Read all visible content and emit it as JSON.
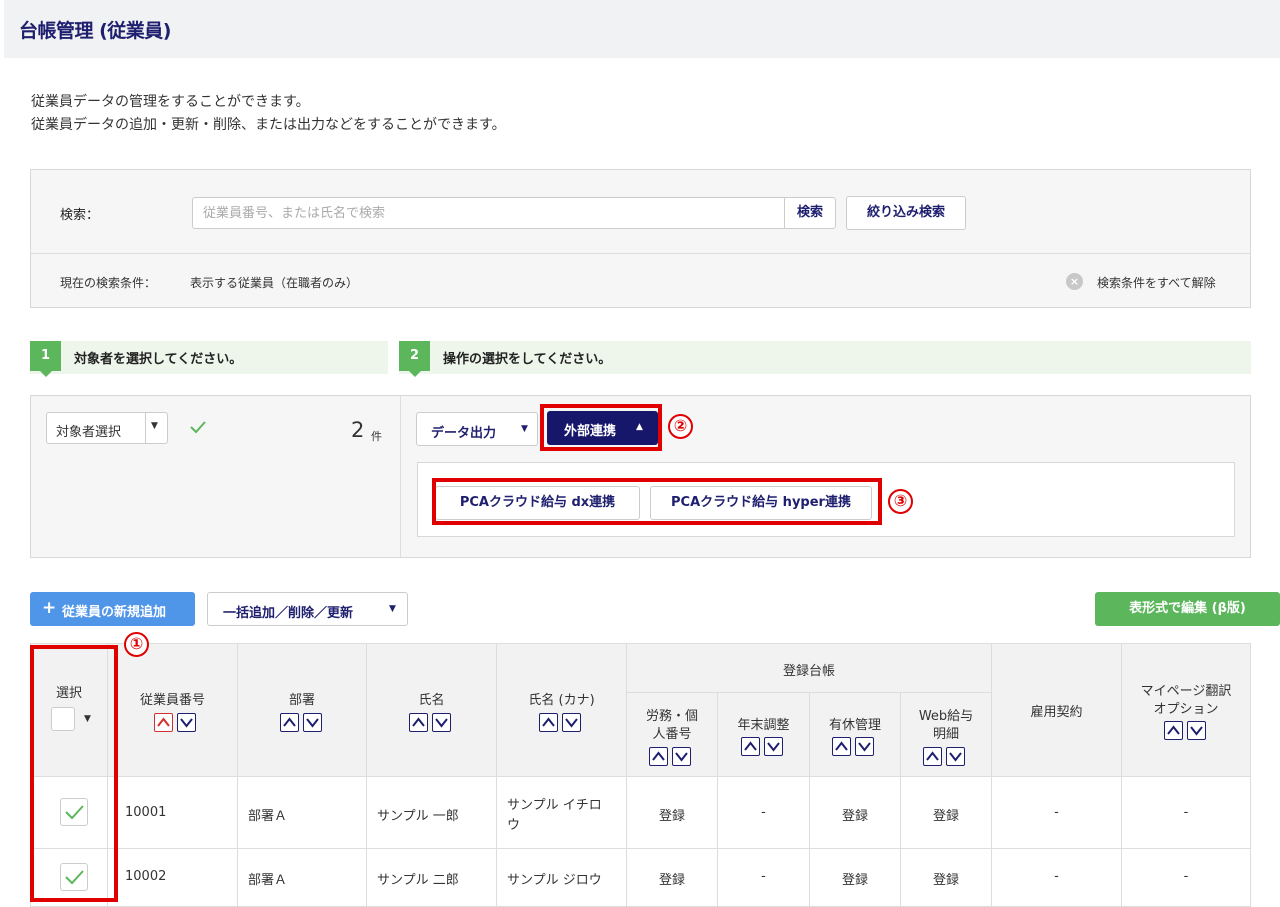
{
  "header": {
    "title": "台帳管理 (従業員)"
  },
  "description": {
    "line1": "従業員データの管理をすることができます。",
    "line2": "従業員データの追加・更新・削除、または出力などをすることができます。"
  },
  "search": {
    "label": "検索：",
    "placeholder": "従業員番号、または氏名で検索",
    "search_button": "検索",
    "filter_button": "絞り込み検索",
    "condition_label": "現在の検索条件：",
    "condition_value": "表示する従業員（在職者のみ）",
    "clear_all": "検索条件をすべて解除"
  },
  "steps": [
    {
      "number": "1",
      "label": "対象者を選択してください。"
    },
    {
      "number": "2",
      "label": "操作の選択をしてください。"
    }
  ],
  "selection": {
    "dropdown_label": "対象者選択",
    "count": "2",
    "count_unit": "件"
  },
  "operations": {
    "data_output": "データ出力",
    "external_link": "外部連携",
    "pca_dx": "PCAクラウド給与 dx連携",
    "pca_hyper": "PCAクラウド給与 hyper連携"
  },
  "annotations": {
    "one": "①",
    "two": "②",
    "three": "③"
  },
  "toolbar": {
    "add_employee": "従業員の新規追加",
    "bulk": "一括追加／削除／更新",
    "table_edit": "表形式で編集 (β版)"
  },
  "table": {
    "headers": {
      "select": "選択",
      "emp_no": "従業員番号",
      "dept": "部署",
      "name": "氏名",
      "kana": "氏名 (カナ)",
      "registry": "登録台帳",
      "labor_l1": "労務・個",
      "labor_l2": "人番号",
      "year_end": "年末調整",
      "leave": "有休管理",
      "web_l1": "Web給与",
      "web_l2": "明細",
      "contract": "雇用契約",
      "mypage_l1": "マイページ翻訳",
      "mypage_l2": "オプション"
    },
    "rows": [
      {
        "emp_no": "10001",
        "dept": "部署Ａ",
        "name": "サンプル 一郎",
        "kana_l1": "サンプル イチロ",
        "kana_l2": "ウ",
        "labor": "登録",
        "year_end": "-",
        "leave": "登録",
        "web": "登録",
        "contract": "-",
        "mypage": "-"
      },
      {
        "emp_no": "10002",
        "dept": "部署Ａ",
        "name": "サンプル 二郎",
        "kana_l1": "サンプル ジロウ",
        "kana_l2": "",
        "labor": "登録",
        "year_end": "-",
        "leave": "登録",
        "web": "登録",
        "contract": "-",
        "mypage": "-"
      }
    ]
  },
  "colors": {
    "navy": "#1e1f6e",
    "green": "#5cb75c",
    "blue": "#4f95e8",
    "red": "#e00000"
  },
  "icons": [
    "clear-icon",
    "check-icon",
    "caret-down-icon",
    "caret-up-icon",
    "sort-asc-icon",
    "sort-desc-icon",
    "plus-icon"
  ]
}
